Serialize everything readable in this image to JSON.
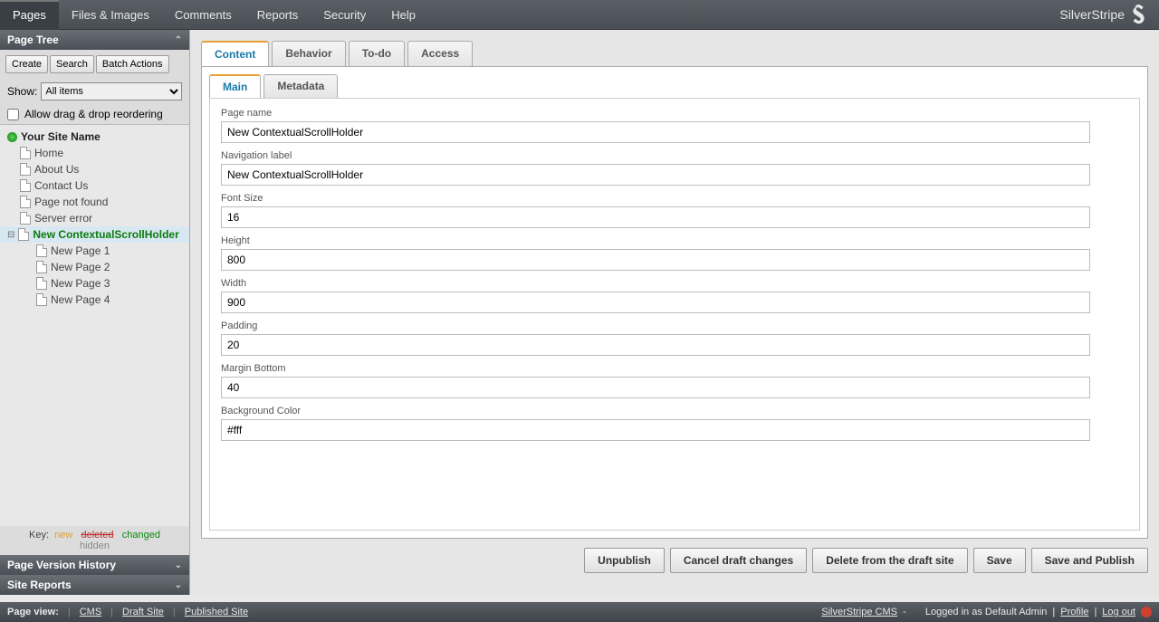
{
  "topnav": {
    "tabs": [
      "Pages",
      "Files & Images",
      "Comments",
      "Reports",
      "Security",
      "Help"
    ],
    "brand": "SilverStripe"
  },
  "sidebar": {
    "page_tree_title": "Page Tree",
    "buttons": {
      "create": "Create",
      "search": "Search",
      "batch": "Batch Actions"
    },
    "show_label": "Show:",
    "show_value": "All items",
    "reorder_label": "Allow drag & drop reordering",
    "site_name": "Your Site Name",
    "items": [
      {
        "label": "Home"
      },
      {
        "label": "About Us"
      },
      {
        "label": "Contact Us"
      },
      {
        "label": "Page not found"
      },
      {
        "label": "Server error"
      }
    ],
    "selected": {
      "label": "New ContextualScrollHolder"
    },
    "children": [
      {
        "label": "New Page 1"
      },
      {
        "label": "New Page 2"
      },
      {
        "label": "New Page 3"
      },
      {
        "label": "New Page 4"
      }
    ],
    "key": {
      "label": "Key:",
      "new": "new",
      "deleted": "deleted",
      "changed": "changed",
      "hidden": "hidden"
    },
    "version_history": "Page Version History",
    "site_reports": "Site Reports"
  },
  "tabs_outer": [
    "Content",
    "Behavior",
    "To-do",
    "Access"
  ],
  "tabs_inner": [
    "Main",
    "Metadata"
  ],
  "form": {
    "fields": [
      {
        "label": "Page name",
        "value": "New ContextualScrollHolder"
      },
      {
        "label": "Navigation label",
        "value": "New ContextualScrollHolder"
      },
      {
        "label": "Font Size",
        "value": "16"
      },
      {
        "label": "Height",
        "value": "800"
      },
      {
        "label": "Width",
        "value": "900"
      },
      {
        "label": "Padding",
        "value": "20"
      },
      {
        "label": "Margin Bottom",
        "value": "40"
      },
      {
        "label": "Background Color",
        "value": "#fff"
      }
    ]
  },
  "actions": {
    "unpublish": "Unpublish",
    "cancel": "Cancel draft changes",
    "delete": "Delete from the draft site",
    "save": "Save",
    "save_publish": "Save and Publish"
  },
  "footer": {
    "page_view": "Page view:",
    "cms": "CMS",
    "draft": "Draft Site",
    "published": "Published Site",
    "product": "SilverStripe CMS",
    "dash": "-",
    "logged_in": "Logged in as Default Admin",
    "profile": "Profile",
    "logout": "Log out"
  }
}
